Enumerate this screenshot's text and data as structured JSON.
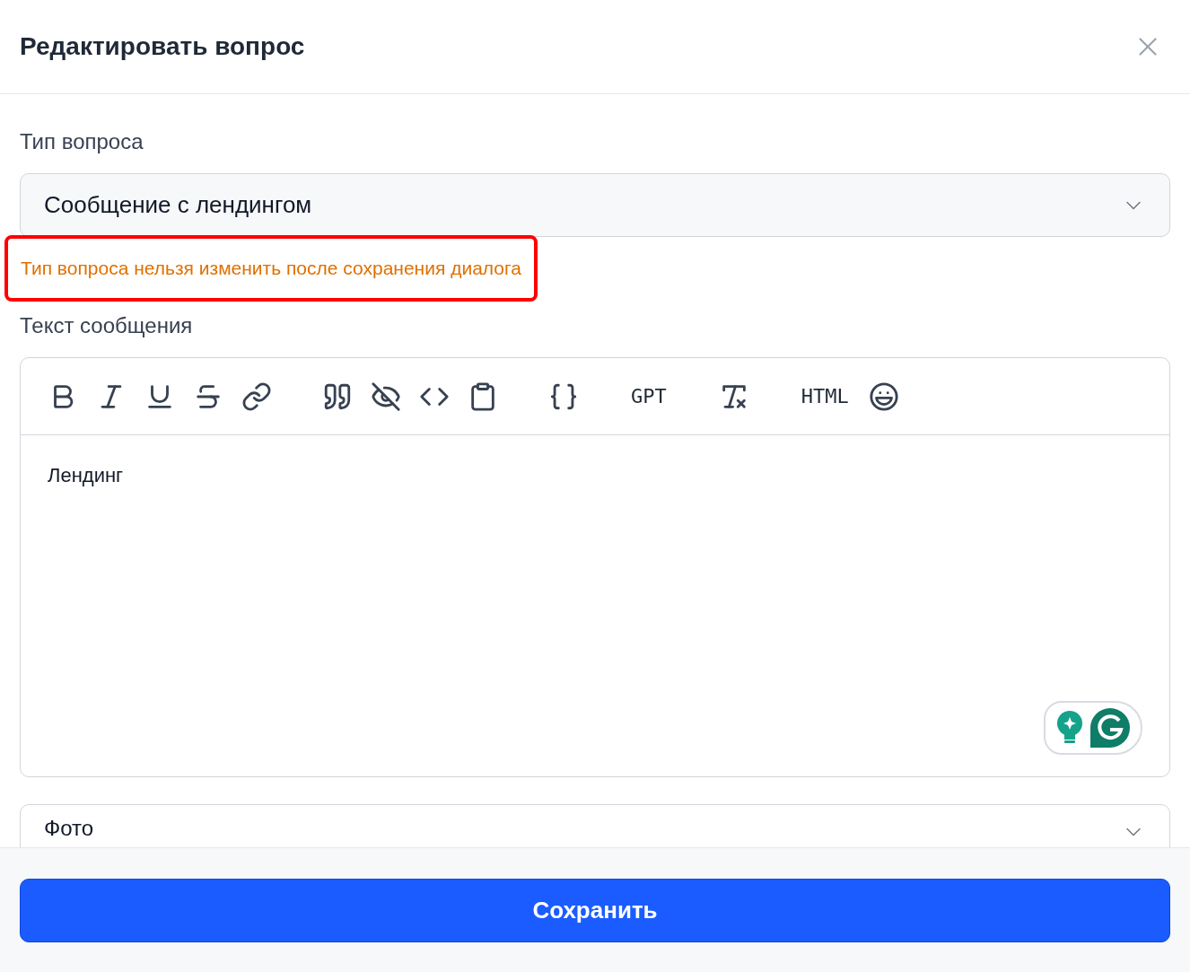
{
  "dialog": {
    "title": "Редактировать вопрос"
  },
  "question_type": {
    "label": "Тип вопроса",
    "value": "Сообщение с лендингом",
    "warning": "Тип вопроса нельзя изменить после сохранения диалога",
    "highlighted": true
  },
  "message": {
    "label": "Текст сообщения",
    "toolbar": [
      {
        "kind": "icon"
      },
      {
        "kind": "icon"
      },
      {
        "kind": "icon"
      },
      {
        "kind": "icon"
      },
      {
        "kind": "icon"
      },
      {
        "kind": "gap"
      },
      {
        "kind": "icon"
      },
      {
        "kind": "icon"
      },
      {
        "kind": "icon"
      },
      {
        "kind": "icon"
      },
      {
        "kind": "gap"
      },
      {
        "kind": "icon"
      },
      {
        "kind": "gap"
      },
      {
        "kind": "text",
        "label": "GPT"
      },
      {
        "kind": "gap"
      },
      {
        "kind": "icon"
      },
      {
        "kind": "gap"
      },
      {
        "kind": "text",
        "label": "HTML"
      },
      {
        "kind": "icon"
      }
    ],
    "content": "Лендинг"
  },
  "photo": {
    "label": "Фото"
  },
  "footer": {
    "button": "Сохранить"
  }
}
